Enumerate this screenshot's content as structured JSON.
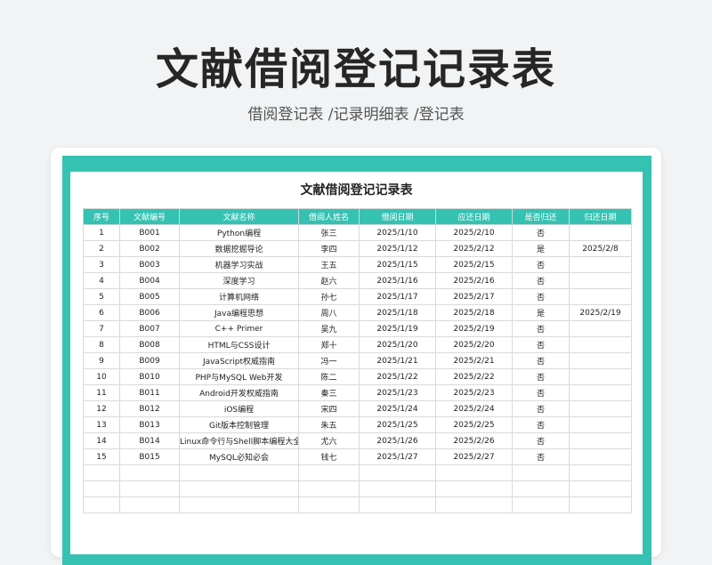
{
  "header": {
    "title": "文献借阅登记记录表",
    "subtitle": "借阅登记表 /记录明细表 /登记表"
  },
  "sheet": {
    "title": "文献借阅登记记录表",
    "columns": [
      "序号",
      "文献编号",
      "文献名称",
      "借阅人姓名",
      "借阅日期",
      "应还日期",
      "是否归还",
      "归还日期"
    ],
    "rows": [
      [
        "1",
        "B001",
        "Python编程",
        "张三",
        "2025/1/10",
        "2025/2/10",
        "否",
        ""
      ],
      [
        "2",
        "B002",
        "数据挖掘导论",
        "李四",
        "2025/1/12",
        "2025/2/12",
        "是",
        "2025/2/8"
      ],
      [
        "3",
        "B003",
        "机器学习实战",
        "王五",
        "2025/1/15",
        "2025/2/15",
        "否",
        ""
      ],
      [
        "4",
        "B004",
        "深度学习",
        "赵六",
        "2025/1/16",
        "2025/2/16",
        "否",
        ""
      ],
      [
        "5",
        "B005",
        "计算机网络",
        "孙七",
        "2025/1/17",
        "2025/2/17",
        "否",
        ""
      ],
      [
        "6",
        "B006",
        "Java编程思想",
        "周八",
        "2025/1/18",
        "2025/2/18",
        "是",
        "2025/2/19"
      ],
      [
        "7",
        "B007",
        "C++ Primer",
        "吴九",
        "2025/1/19",
        "2025/2/19",
        "否",
        ""
      ],
      [
        "8",
        "B008",
        "HTML与CSS设计",
        "郑十",
        "2025/1/20",
        "2025/2/20",
        "否",
        ""
      ],
      [
        "9",
        "B009",
        "JavaScript权威指南",
        "冯一",
        "2025/1/21",
        "2025/2/21",
        "否",
        ""
      ],
      [
        "10",
        "B010",
        "PHP与MySQL Web开发",
        "陈二",
        "2025/1/22",
        "2025/2/22",
        "否",
        ""
      ],
      [
        "11",
        "B011",
        "Android开发权威指南",
        "秦三",
        "2025/1/23",
        "2025/2/23",
        "否",
        ""
      ],
      [
        "12",
        "B012",
        "iOS编程",
        "宋四",
        "2025/1/24",
        "2025/2/24",
        "否",
        ""
      ],
      [
        "13",
        "B013",
        "Git版本控制管理",
        "朱五",
        "2025/1/25",
        "2025/2/25",
        "否",
        ""
      ],
      [
        "14",
        "B014",
        "Linux命令行与Shell脚本编程大全",
        "尤六",
        "2025/1/26",
        "2025/2/26",
        "否",
        ""
      ],
      [
        "15",
        "B015",
        "MySQL必知必会",
        "钱七",
        "2025/1/27",
        "2025/2/27",
        "否",
        ""
      ]
    ],
    "empty_rows": 3
  },
  "colors": {
    "accent": "#35c2b2",
    "title_text": "#262626",
    "background": "#f1f3f5"
  }
}
